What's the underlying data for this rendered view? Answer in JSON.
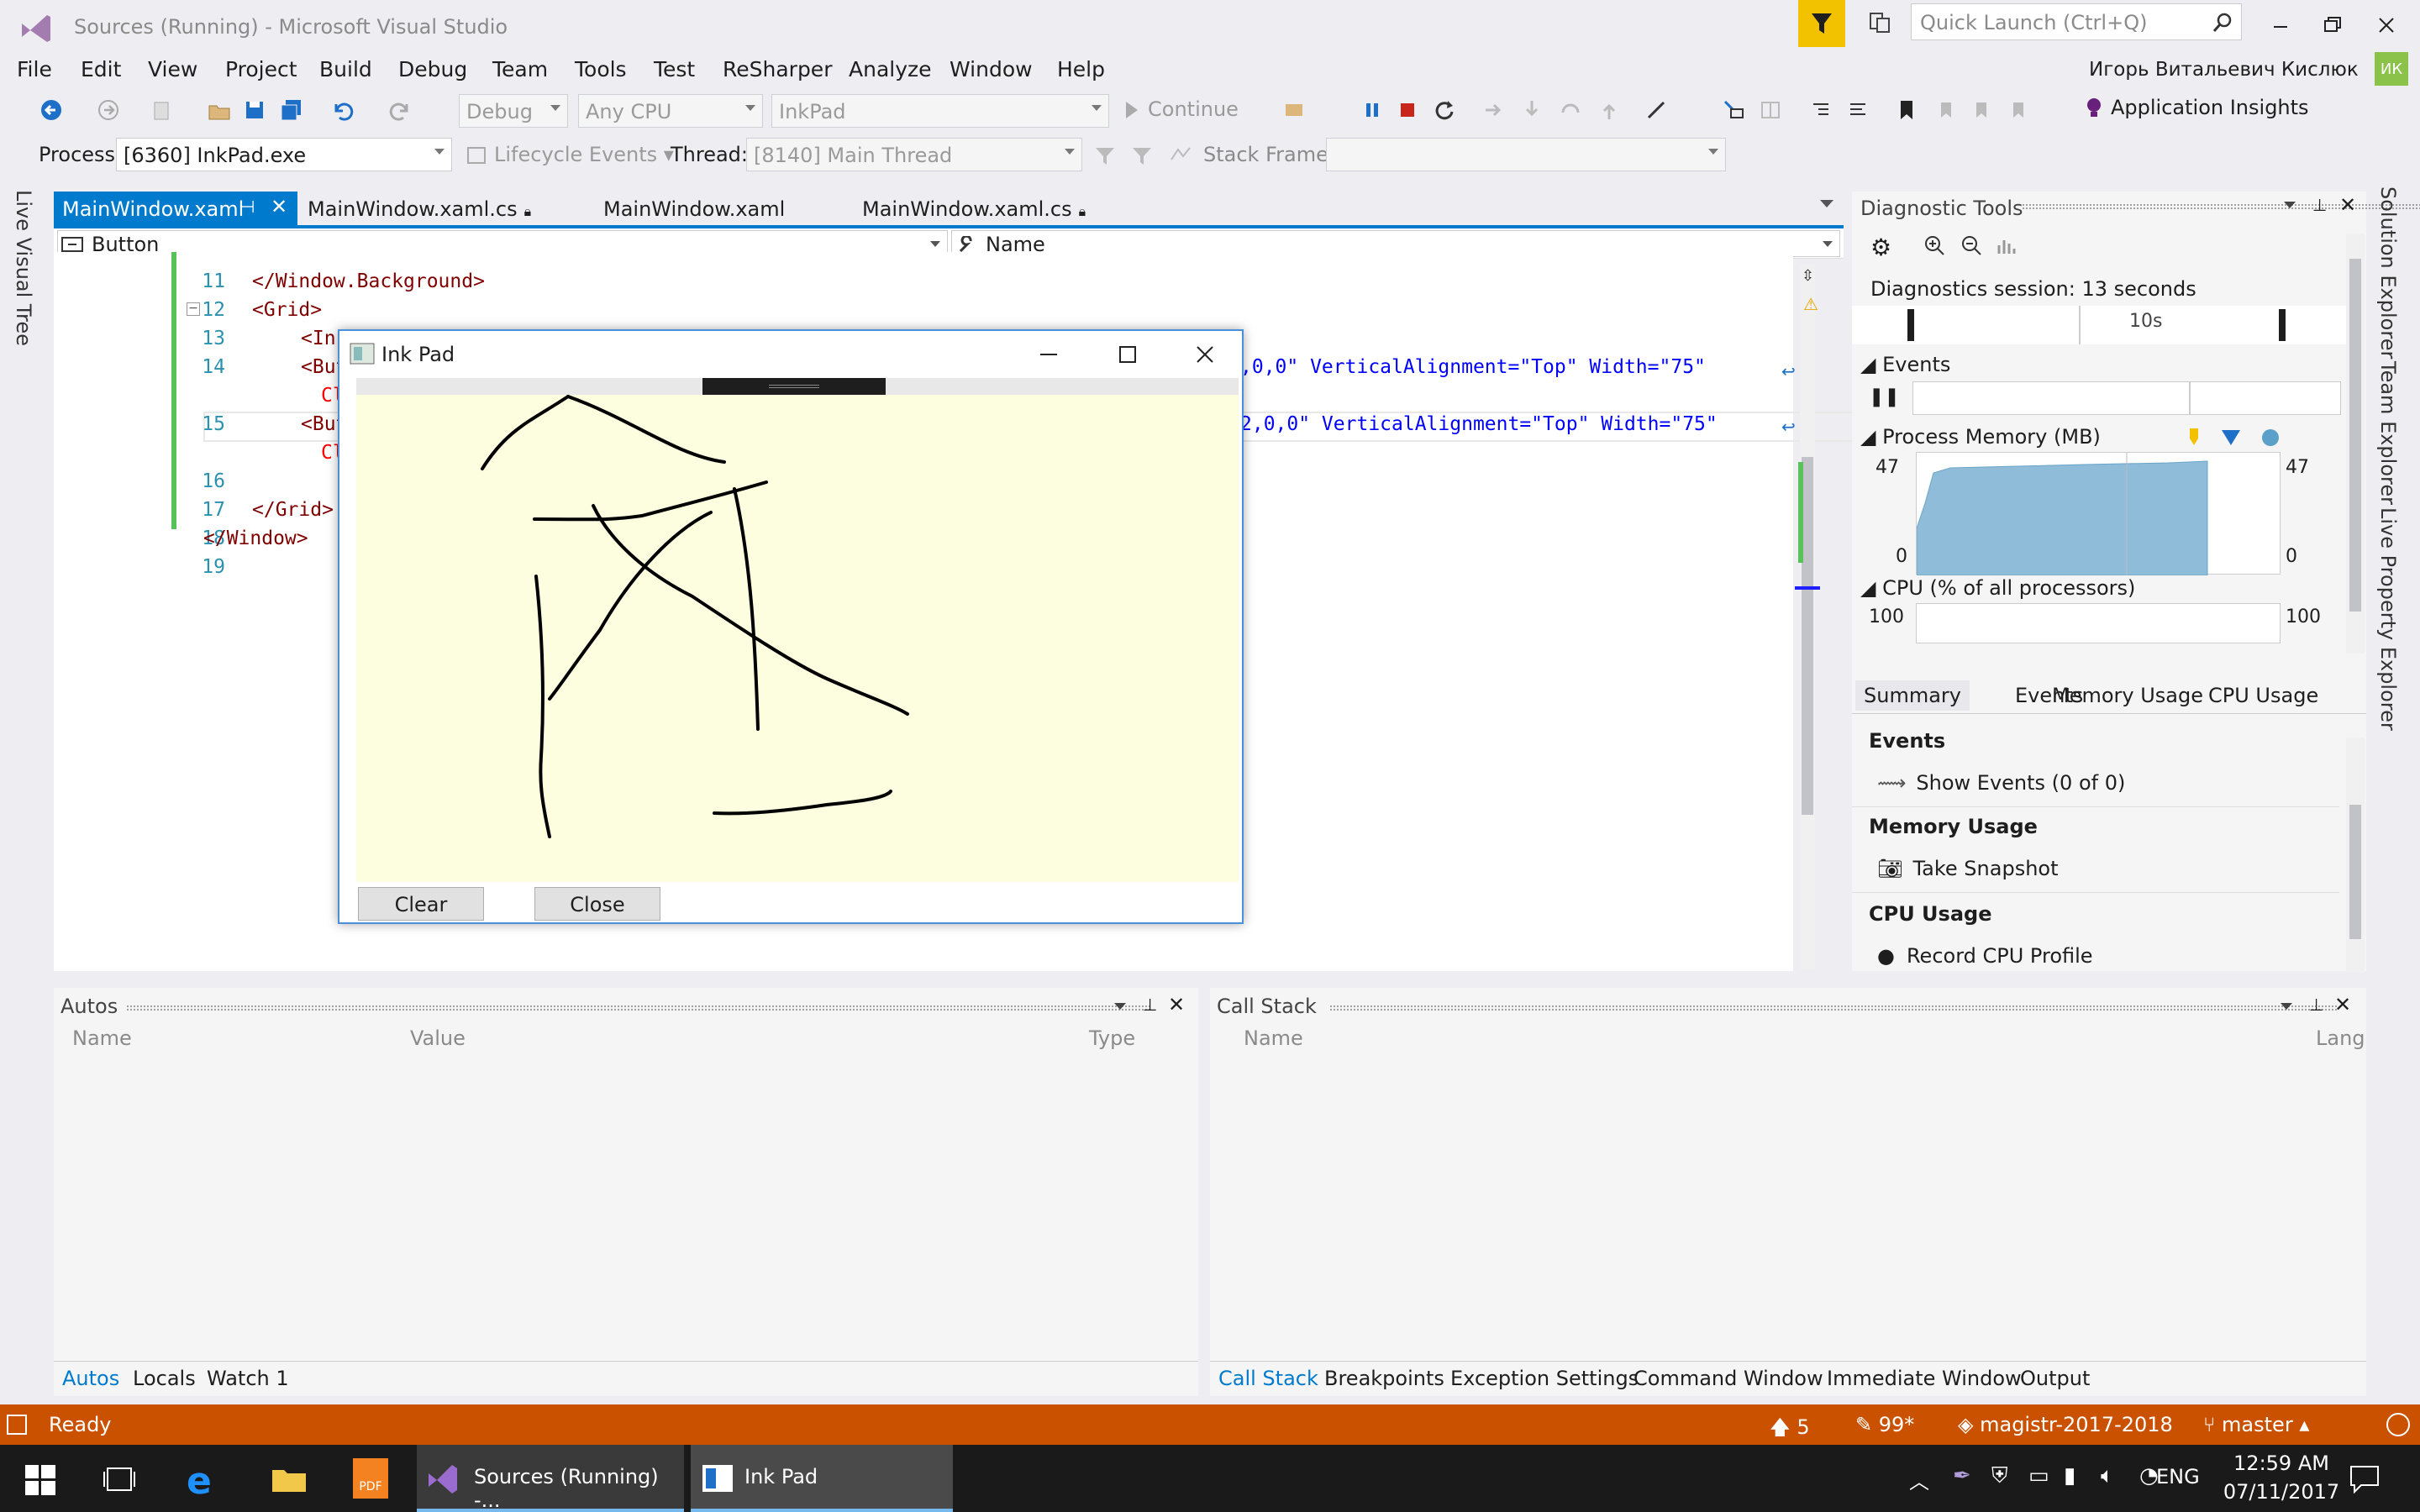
{
  "window": {
    "title": "Sources (Running) - Microsoft Visual Studio",
    "quick_launch_placeholder": "Quick Launch (Ctrl+Q)",
    "user": "Игорь Витальевич Кислюк",
    "user_initials": "ИК"
  },
  "menu": [
    "File",
    "Edit",
    "View",
    "Project",
    "Build",
    "Debug",
    "Team",
    "Tools",
    "Test",
    "ReSharper",
    "Analyze",
    "Window",
    "Help"
  ],
  "toolbar": {
    "config": "Debug",
    "platform": "Any CPU",
    "project": "InkPad",
    "continue": "Continue",
    "app_insights": "Application Insights"
  },
  "debugbar": {
    "process_label": "Process:",
    "process": "[6360] InkPad.exe",
    "lifecycle": "Lifecycle Events",
    "thread_label": "Thread:",
    "thread": "[8140] Main Thread",
    "stack_label": "Stack Frame:",
    "stack": ""
  },
  "tabs": [
    {
      "label": "MainWindow.xaml",
      "active": true
    },
    {
      "label": "MainWindow.xaml.cs"
    },
    {
      "label": "MainWindow.xaml"
    },
    {
      "label": "MainWindow.xaml.cs"
    }
  ],
  "nav": {
    "left": "Button",
    "right": "Name"
  },
  "code": {
    "lines": [
      {
        "n": "11",
        "text": "</Window.Background>"
      },
      {
        "n": "12",
        "text": "<Grid>"
      },
      {
        "n": "13",
        "text": "<Ink"
      },
      {
        "n": "14",
        "text": "<But"
      },
      {
        "n": "",
        "text": "Cl"
      },
      {
        "n": "15",
        "text": "<But"
      },
      {
        "n": "",
        "text": "Cl"
      },
      {
        "n": "16",
        "text": ""
      },
      {
        "n": "17",
        "text": "</Grid>"
      },
      {
        "n": "18",
        "text": "</Window>"
      },
      {
        "n": "19",
        "text": ""
      }
    ],
    "line14_tail": ",0,0\" VerticalAlignment=\"Top\" Width=\"75\"",
    "line15_tail": "2,0,0\" VerticalAlignment=\"Top\" Width=\"75\""
  },
  "inkpad": {
    "title": "Ink Pad",
    "clear": "Clear",
    "close": "Close"
  },
  "diag": {
    "title": "Diagnostic Tools",
    "session": "Diagnostics session: 13 seconds",
    "time_tick": "10s",
    "events": "Events",
    "memory": "Process Memory (MB)",
    "mem_max": "47",
    "mem_min": "0",
    "cpu": "CPU (% of all processors)",
    "cpu_max": "100",
    "tabs": [
      "Summary",
      "Events",
      "Memory Usage",
      "CPU Usage"
    ],
    "sec_events": "Events",
    "show_events": "Show Events (0 of 0)",
    "sec_memory": "Memory Usage",
    "take_snapshot": "Take Snapshot",
    "sec_cpu": "CPU Usage",
    "record_cpu": "Record CPU Profile"
  },
  "autos": {
    "title": "Autos",
    "cols": [
      "Name",
      "Value",
      "Type"
    ],
    "tabs": [
      "Autos",
      "Locals",
      "Watch 1"
    ]
  },
  "callstack": {
    "title": "Call Stack",
    "cols": [
      "Name",
      "Lang"
    ],
    "tabs": [
      "Call Stack",
      "Breakpoints",
      "Exception Settings",
      "Command Window",
      "Immediate Window",
      "Output"
    ]
  },
  "side_tabs": {
    "left": "Live Visual Tree",
    "right": [
      "Solution Explorer",
      "Team Explorer",
      "Live Property Explorer"
    ]
  },
  "status": {
    "ready": "Ready",
    "up": "5",
    "edits": "99*",
    "repo": "magistr-2017-2018",
    "branch": "master"
  },
  "taskbar": {
    "vs_task": "Sources (Running) -...",
    "ink_task": "Ink Pad",
    "lang": "ENG",
    "time": "12:59 AM",
    "date": "07/11/2017"
  },
  "colors": {
    "accent": "#007acc",
    "status": "#ca5100",
    "ink_bg": "#fdfde0"
  }
}
